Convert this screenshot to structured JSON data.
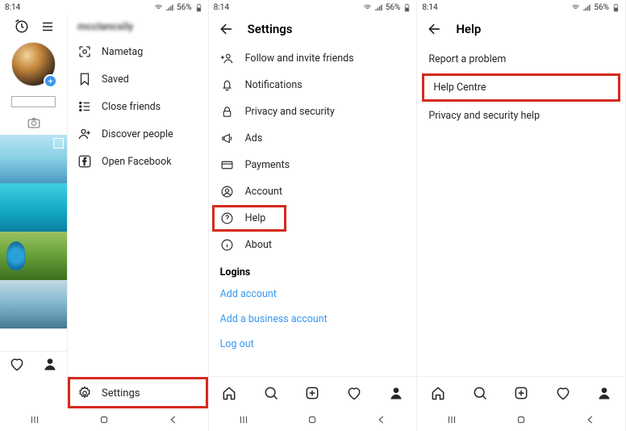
{
  "status": {
    "time": "8:14",
    "battery_pct": "56%"
  },
  "panel1": {
    "username": "mcclancsily",
    "menu": [
      {
        "key": "nametag",
        "label": "Nametag"
      },
      {
        "key": "saved",
        "label": "Saved"
      },
      {
        "key": "closefriends",
        "label": "Close friends"
      },
      {
        "key": "discover",
        "label": "Discover people"
      },
      {
        "key": "openfb",
        "label": "Open Facebook"
      }
    ],
    "settings_label": "Settings"
  },
  "panel2": {
    "title": "Settings",
    "items": [
      {
        "key": "follow",
        "label": "Follow and invite friends"
      },
      {
        "key": "notifications",
        "label": "Notifications"
      },
      {
        "key": "privacy",
        "label": "Privacy and security"
      },
      {
        "key": "ads",
        "label": "Ads"
      },
      {
        "key": "payments",
        "label": "Payments"
      },
      {
        "key": "account",
        "label": "Account"
      },
      {
        "key": "help",
        "label": "Help"
      },
      {
        "key": "about",
        "label": "About"
      }
    ],
    "logins_title": "Logins",
    "add_account": "Add account",
    "add_business": "Add a business account",
    "logout": "Log out"
  },
  "panel3": {
    "title": "Help",
    "items": [
      {
        "key": "report",
        "label": "Report a problem"
      },
      {
        "key": "helpcentre",
        "label": "Help Centre"
      },
      {
        "key": "privacyhelp",
        "label": "Privacy and security help"
      }
    ]
  },
  "highlights": {
    "panel1_settings": true,
    "panel2_help": true,
    "panel3_helpcentre": true
  }
}
